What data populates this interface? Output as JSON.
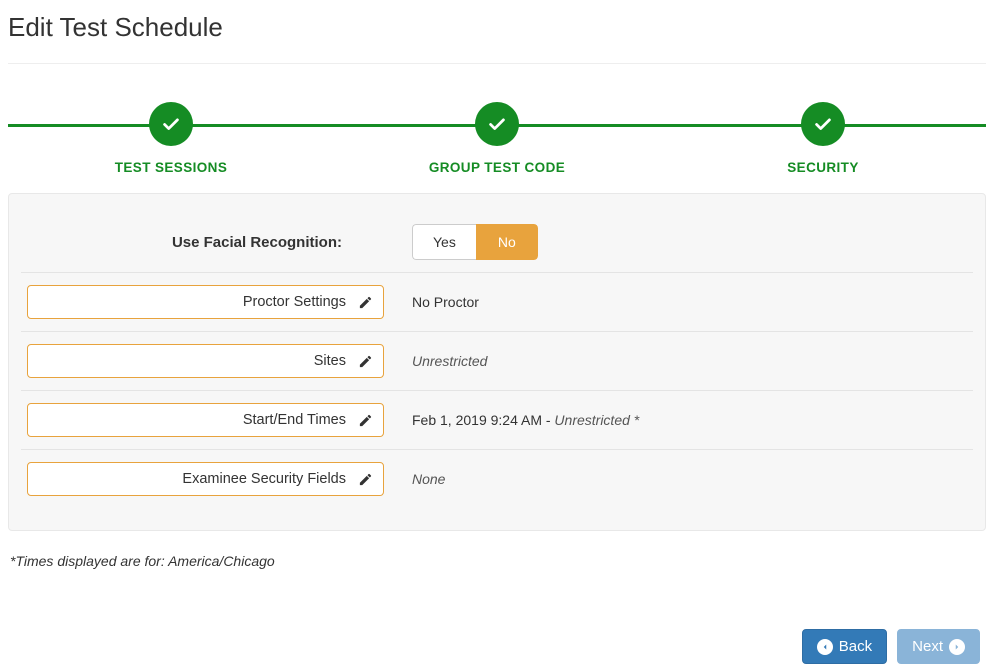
{
  "page": {
    "title": "Edit Test Schedule"
  },
  "stepper": {
    "steps": [
      {
        "label": "TEST SESSIONS",
        "status": "done"
      },
      {
        "label": "GROUP TEST CODE",
        "status": "done"
      },
      {
        "label": "SECURITY",
        "status": "done"
      }
    ]
  },
  "security_panel": {
    "facial_recognition": {
      "label": "Use Facial Recognition:",
      "options": {
        "yes": "Yes",
        "no": "No"
      },
      "value": "No"
    },
    "rows": [
      {
        "key": "proctor",
        "label": "Proctor Settings",
        "value": "No Proctor",
        "italic": false
      },
      {
        "key": "sites",
        "label": "Sites",
        "value": "Unrestricted",
        "italic": true
      },
      {
        "key": "times",
        "label": "Start/End Times",
        "value_prefix": "Feb 1, 2019 9:24 AM - ",
        "value_suffix_italic": "Unrestricted *"
      },
      {
        "key": "examinee_security",
        "label": "Examinee Security Fields",
        "value": "None",
        "italic": true
      }
    ]
  },
  "footer": {
    "tz_note": "*Times displayed are for: America/Chicago",
    "back_label": "Back",
    "next_label": "Next"
  },
  "colors": {
    "brand_green": "#158c24",
    "accent_orange": "#e8a33d",
    "primary_blue": "#337ab7"
  }
}
